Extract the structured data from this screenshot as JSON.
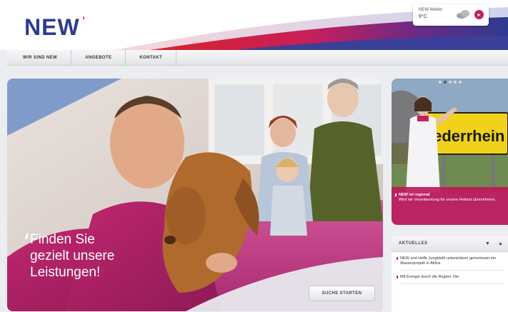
{
  "header": {
    "logo": "NEW",
    "weather": {
      "city": "NEW Wetter",
      "temp": "9°C",
      "go_icon": "arrow-right-icon"
    }
  },
  "nav": {
    "items": [
      {
        "label": "WIR SIND NEW"
      },
      {
        "label": "ANGEBOTE"
      },
      {
        "label": "KONTAKT"
      }
    ]
  },
  "hero": {
    "tagline_line1": "Finden Sie",
    "tagline_line2": "gezielt unsere",
    "tagline_line3": "Leistungen!",
    "button_label": "SUCHE STARTEN"
  },
  "promo": {
    "sign_text": "iederrhein",
    "caption_title": "NEW ist regional",
    "caption_text": "Wird wir Verantwortung für unsere Heimat übernehmen.",
    "slides_count": 5,
    "active_slide": 2
  },
  "news": {
    "title": "AKTUELLES",
    "items": [
      {
        "text": "NEW und Hoffe Jungbluth unterstützen gemeinsam ein Wasserprojekt in Afrika."
      },
      {
        "text": "Mit Energie durch die Region: Die"
      }
    ]
  },
  "colors": {
    "brand_blue": "#2d3c8f",
    "brand_magenta": "#c71f5b",
    "red": "#d8232a"
  }
}
